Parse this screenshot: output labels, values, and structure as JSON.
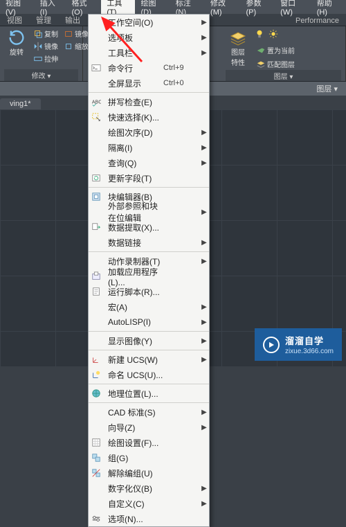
{
  "menubar": [
    {
      "label": "视图(V)"
    },
    {
      "label": "插入(I)"
    },
    {
      "label": "格式(O)"
    },
    {
      "label": "工具(T)"
    },
    {
      "label": "绘图(D)"
    },
    {
      "label": "标注(N)"
    },
    {
      "label": "修改(M)"
    },
    {
      "label": "参数(P)"
    },
    {
      "label": "窗口(W)"
    },
    {
      "label": "帮助(H)"
    }
  ],
  "active_menu_index": 3,
  "tabstrip": [
    {
      "label": "视图"
    },
    {
      "label": "管理"
    },
    {
      "label": "输出"
    }
  ],
  "tabstrip_right": "Performance",
  "ribbon": {
    "group1": {
      "big": "旋转",
      "small": [
        "复制",
        "镜像",
        "拉伸",
        "缩放"
      ],
      "title": "修改 ▾"
    },
    "group2": {
      "big": "图层",
      "small": "特性",
      "set_current": "置为当前",
      "match": "匹配图层",
      "title": "图层 ▾"
    }
  },
  "drawing_tab": "ving1*",
  "layer_row_label": "图层 ▾",
  "menu_items": [
    {
      "label": "工作空间(O)",
      "icon": "",
      "sub": true
    },
    {
      "label": "选项板",
      "icon": "",
      "sub": true
    },
    {
      "label": "工具栏",
      "icon": "",
      "sub": true
    },
    {
      "label": "命令行",
      "icon": "cmd",
      "shortcut": "Ctrl+9"
    },
    {
      "label": "全屏显示",
      "icon": "",
      "shortcut": "Ctrl+0"
    },
    {
      "sep": true
    },
    {
      "label": "拼写检查(E)",
      "icon": "abc"
    },
    {
      "label": "快速选择(K)...",
      "icon": "qsel"
    },
    {
      "label": "绘图次序(D)",
      "icon": "",
      "sub": true
    },
    {
      "label": "隔离(I)",
      "icon": "",
      "sub": true
    },
    {
      "label": "查询(Q)",
      "icon": "",
      "sub": true
    },
    {
      "label": "更新字段(T)",
      "icon": "upd"
    },
    {
      "sep": true
    },
    {
      "label": "块编辑器(B)",
      "icon": "blk"
    },
    {
      "label": "外部参照和块在位编辑",
      "icon": "",
      "sub": true
    },
    {
      "label": "数据提取(X)...",
      "icon": "dx"
    },
    {
      "label": "数据链接",
      "icon": "",
      "sub": true
    },
    {
      "sep": true
    },
    {
      "label": "动作录制器(T)",
      "icon": "",
      "sub": true
    },
    {
      "label": "加载应用程序(L)...",
      "icon": "app"
    },
    {
      "label": "运行脚本(R)...",
      "icon": "scr"
    },
    {
      "label": "宏(A)",
      "icon": "",
      "sub": true
    },
    {
      "label": "AutoLISP(I)",
      "icon": "",
      "sub": true
    },
    {
      "sep": true
    },
    {
      "label": "显示图像(Y)",
      "icon": "",
      "sub": true
    },
    {
      "sep": true
    },
    {
      "label": "新建 UCS(W)",
      "icon": "ucs",
      "sub": true
    },
    {
      "label": "命名 UCS(U)...",
      "icon": "nucs"
    },
    {
      "sep": true
    },
    {
      "label": "地理位置(L)...",
      "icon": "geo"
    },
    {
      "sep": true
    },
    {
      "label": "CAD 标准(S)",
      "icon": "",
      "sub": true
    },
    {
      "label": "向导(Z)",
      "icon": "",
      "sub": true
    },
    {
      "label": "绘图设置(F)...",
      "icon": "ds"
    },
    {
      "label": "组(G)",
      "icon": "grp"
    },
    {
      "label": "解除编组(U)",
      "icon": "ugrp"
    },
    {
      "label": "数字化仪(B)",
      "icon": "",
      "sub": true
    },
    {
      "label": "自定义(C)",
      "icon": "",
      "sub": true
    },
    {
      "label": "选项(N)...",
      "icon": "opt"
    }
  ],
  "watermark": {
    "bold": "溜溜自学",
    "url": "zixue.3d66.com"
  }
}
